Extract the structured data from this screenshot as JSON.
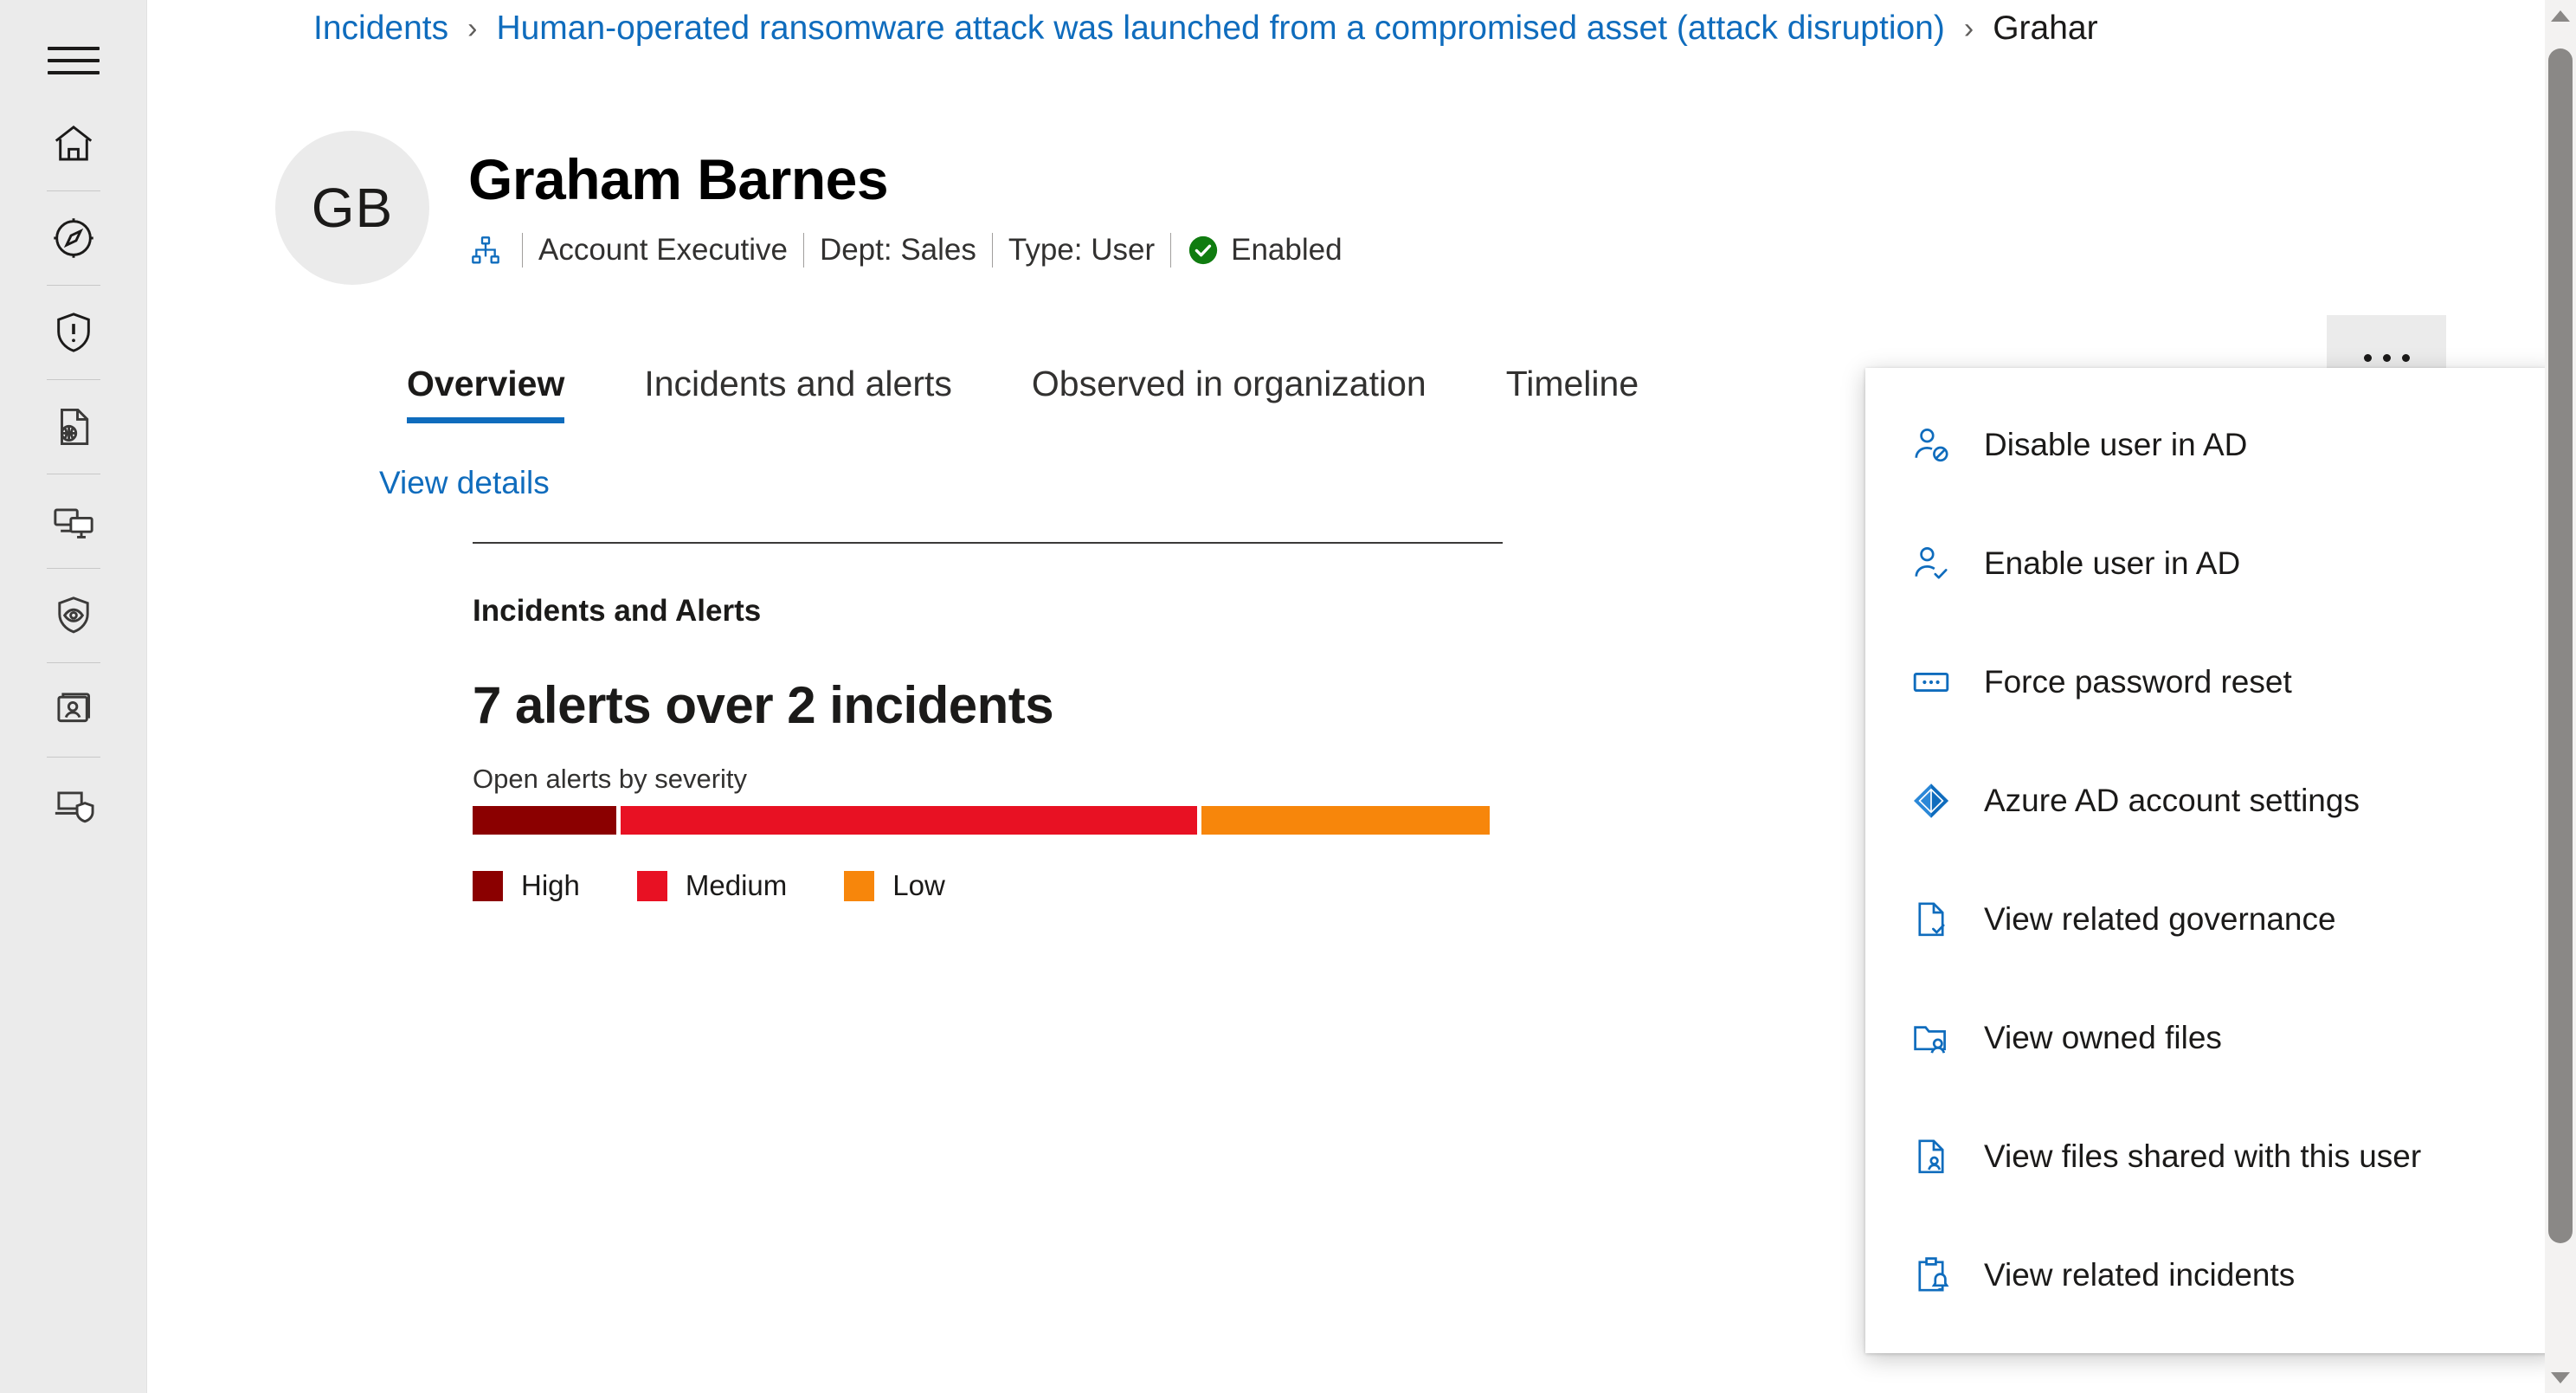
{
  "rail": {
    "menu_label": "hamburger-menu",
    "items": [
      {
        "name": "home",
        "title": "Home"
      },
      {
        "name": "incidents-alerts",
        "title": "Incidents & alerts"
      },
      {
        "name": "hunting",
        "title": "Hunting"
      },
      {
        "name": "actions-submissions",
        "title": "Actions & submissions"
      },
      {
        "name": "assets-devices",
        "title": "Assets"
      },
      {
        "name": "threat-analytics",
        "title": "Threat analytics"
      },
      {
        "name": "identities",
        "title": "Identities"
      },
      {
        "name": "endpoints",
        "title": "Endpoints"
      }
    ]
  },
  "breadcrumb": {
    "items": [
      "Incidents",
      "Human-operated ransomware attack was launched from a compromised asset (attack disruption)",
      "Grahar"
    ],
    "separator": "›"
  },
  "profile": {
    "initials": "GB",
    "name": "Graham Barnes",
    "org_icon": "org-hierarchy-icon",
    "meta": [
      {
        "label": "Account Executive"
      },
      {
        "label": "Dept: Sales"
      },
      {
        "label": "Type: User"
      }
    ],
    "status": {
      "label": "Enabled",
      "icon": "check-circle-icon",
      "color": "#107c10"
    },
    "more_button": {
      "label": "More actions",
      "icon": "ellipsis-icon"
    }
  },
  "tabs": [
    {
      "label": "Overview",
      "active": true
    },
    {
      "label": "Incidents and alerts",
      "active": false
    },
    {
      "label": "Observed in organization",
      "active": false
    },
    {
      "label": "Timeline",
      "active": false
    }
  ],
  "panel": {
    "view_details_label": "View details",
    "section_title": "Incidents and Alerts",
    "headline": "7 alerts over 2 incidents",
    "chart_caption": "Open alerts by severity"
  },
  "chart_data": {
    "type": "bar",
    "orientation": "horizontal-stacked",
    "title": "Open alerts by severity",
    "categories": [
      "High",
      "Medium",
      "Low"
    ],
    "values": [
      1,
      4,
      2
    ],
    "colors": [
      "#8b0000",
      "#e81123",
      "#f7860b"
    ],
    "total_alerts": 7,
    "total_incidents": 2,
    "legend": [
      "High",
      "Medium",
      "Low"
    ],
    "legend_position": "bottom-left",
    "grid": false
  },
  "context_menu": {
    "items": [
      {
        "label": "Disable user in AD",
        "icon": "person-prohibited-icon"
      },
      {
        "label": "Enable user in AD",
        "icon": "person-check-icon"
      },
      {
        "label": "Force password reset",
        "icon": "password-field-icon"
      },
      {
        "label": "Azure AD account settings",
        "icon": "azure-ad-icon"
      },
      {
        "label": "View related governance",
        "icon": "document-check-icon"
      },
      {
        "label": "View owned files",
        "icon": "folder-person-icon"
      },
      {
        "label": "View files shared with this user",
        "icon": "document-person-icon"
      },
      {
        "label": "View related incidents",
        "icon": "clipboard-alert-icon"
      }
    ]
  },
  "scrollbar": {
    "up_label": "scroll-up",
    "down_label": "scroll-down"
  },
  "colors": {
    "accent": "#0f6cbd",
    "rail_bg": "#ebebeb",
    "text": "#1b1a19",
    "severity_high": "#8b0000",
    "severity_medium": "#e81123",
    "severity_low": "#f7860b",
    "status_enabled": "#107c10"
  }
}
